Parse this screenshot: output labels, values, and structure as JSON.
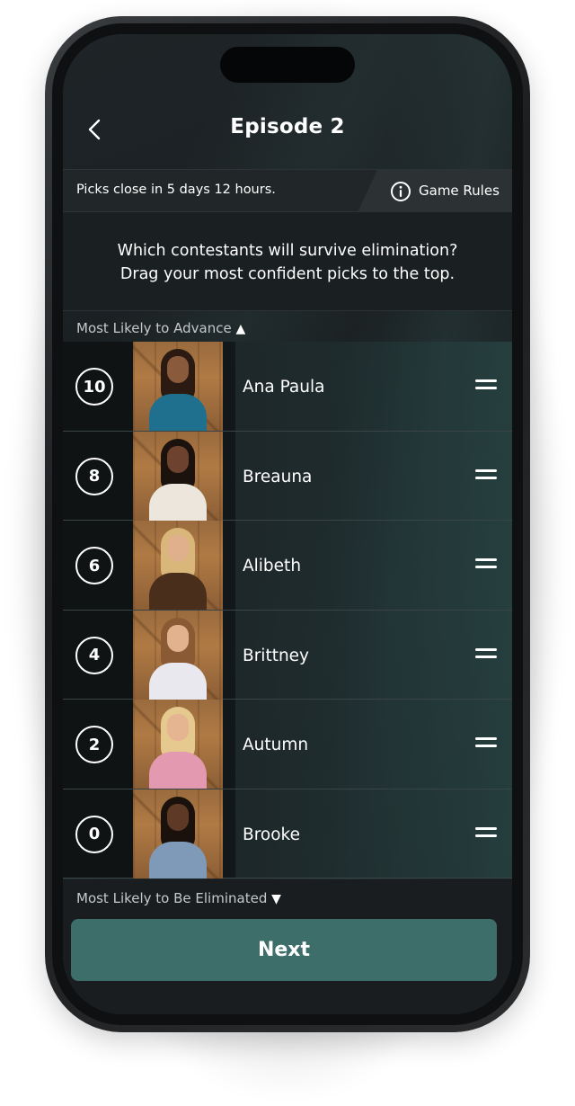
{
  "header": {
    "title": "Episode 2",
    "back_icon": "chevron-left-icon"
  },
  "info_bar": {
    "deadline_text": "Picks close in 5 days 12 hours.",
    "rules_label": "Game Rules",
    "rules_icon": "info-circle-icon"
  },
  "instructions": {
    "line1": "Which contestants will survive elimination?",
    "line2": "Drag your most confident picks to the top."
  },
  "list": {
    "top_label": "Most Likely to Advance",
    "top_arrow": "▲",
    "bottom_label": "Most Likely to Be Eliminated",
    "bottom_arrow": "▼",
    "contestants": [
      {
        "rank": "10",
        "name": "Ana Paula",
        "hair": "#2a1a12",
        "skin": "#8a5a3c",
        "outfit": "#1f6f8f"
      },
      {
        "rank": "8",
        "name": "Breauna",
        "hair": "#1c120d",
        "skin": "#6d4330",
        "outfit": "#ece6dc"
      },
      {
        "rank": "6",
        "name": "Alibeth",
        "hair": "#d9b77a",
        "skin": "#e0b08c",
        "outfit": "#4a2e1c"
      },
      {
        "rank": "4",
        "name": "Brittney",
        "hair": "#8a5a34",
        "skin": "#e2b28e",
        "outfit": "#e8e8ee"
      },
      {
        "rank": "2",
        "name": "Autumn",
        "hair": "#e6c98e",
        "skin": "#e5b592",
        "outfit": "#e39ab0"
      },
      {
        "rank": "0",
        "name": "Brooke",
        "hair": "#1a110c",
        "skin": "#5e3a26",
        "outfit": "#7f9ab8"
      }
    ]
  },
  "footer": {
    "next_label": "Next"
  },
  "colors": {
    "accent": "#3d6e6a",
    "screen_bg": "#1a2022",
    "rank_cell_bg": "#101314"
  }
}
